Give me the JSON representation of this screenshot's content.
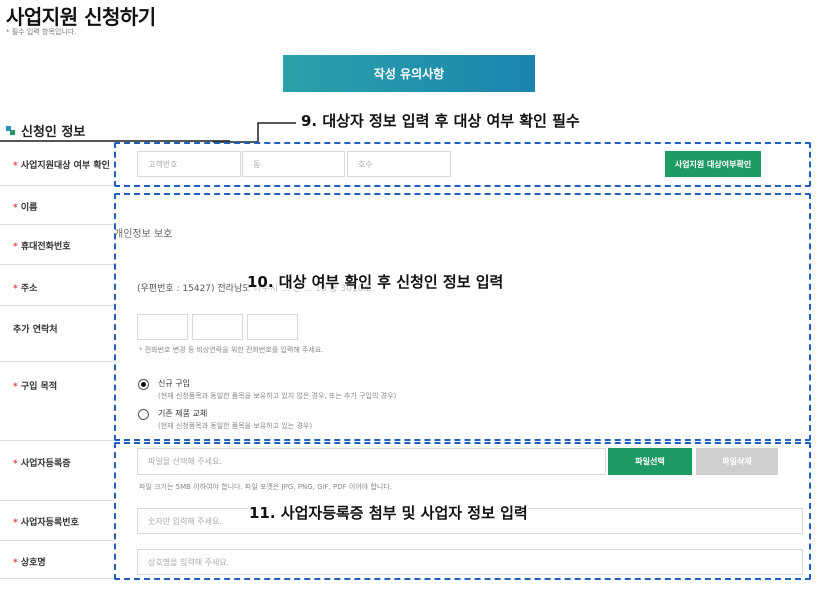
{
  "page": {
    "title": "사업지원 신청하기",
    "required_note": "* 필수 입력 항목입니다.",
    "guide_button": "작성 유의사항"
  },
  "section": {
    "title": "신청인 정보",
    "icon": "square-bullet-icon"
  },
  "annotations": {
    "step9": "9. 대상자 정보 입력 후 대상 여부 확인 필수",
    "step10": "10. 대상 여부 확인 후 신청인 정보 입력",
    "step11": "11. 사업자등록증 첨부 및 사업자 정보 입력"
  },
  "fields": {
    "eligibility": {
      "label": "사업지원대상 여부 확인",
      "customer_no_placeholder": "고객번호",
      "dong_placeholder": "동",
      "ho_placeholder": "호수",
      "check_button": "사업지원 대상여부확인"
    },
    "name": {
      "label": "이름"
    },
    "privacy_text": "개인정보 보호",
    "mobile": {
      "label": "휴대전화번호"
    },
    "address": {
      "label": "주소",
      "value": "(우편번호 : 15427) 전라남도 나주시 ... 신 ... 10 동 3010호"
    },
    "extra_contact": {
      "label": "추가 연락처",
      "hint": "* 전화번호 변경 등 비상연락을 위한 전화번호를 입력해 주세요."
    },
    "purpose": {
      "label": "구입 목적",
      "options": [
        {
          "label": "신규 구입",
          "desc": "(현재 신청품목과 동일한 품목을 보유하고 있지 않은 경우, 또는 추가 구입의 경우)",
          "checked": true
        },
        {
          "label": "기존 제품 교체",
          "desc": "(현재 신청품목과 동일한 품목을 보유하고 있는 경우)",
          "checked": false
        }
      ]
    },
    "business_cert": {
      "label": "사업자등록증",
      "placeholder": "파일을 선택해 주세요.",
      "select_button": "파일선택",
      "delete_button": "파일삭제",
      "hint": "파일 크기는 5MB 이하여야 합니다. 파일 포맷은 JPG, PNG, GIF, PDF 이어야 합니다."
    },
    "business_no": {
      "label": "사업자등록번호",
      "placeholder": "숫자만 입력해 주세요."
    },
    "company_name": {
      "label": "상호명",
      "placeholder": "상호명을 입력해 주세요."
    }
  },
  "colors": {
    "accent_green": "#1e9a63",
    "guide_gradient_start": "#2ba1a9",
    "guide_gradient_end": "#1b85b0",
    "annotation_dash": "#1f5fbf",
    "required_star": "#e04a4a"
  }
}
